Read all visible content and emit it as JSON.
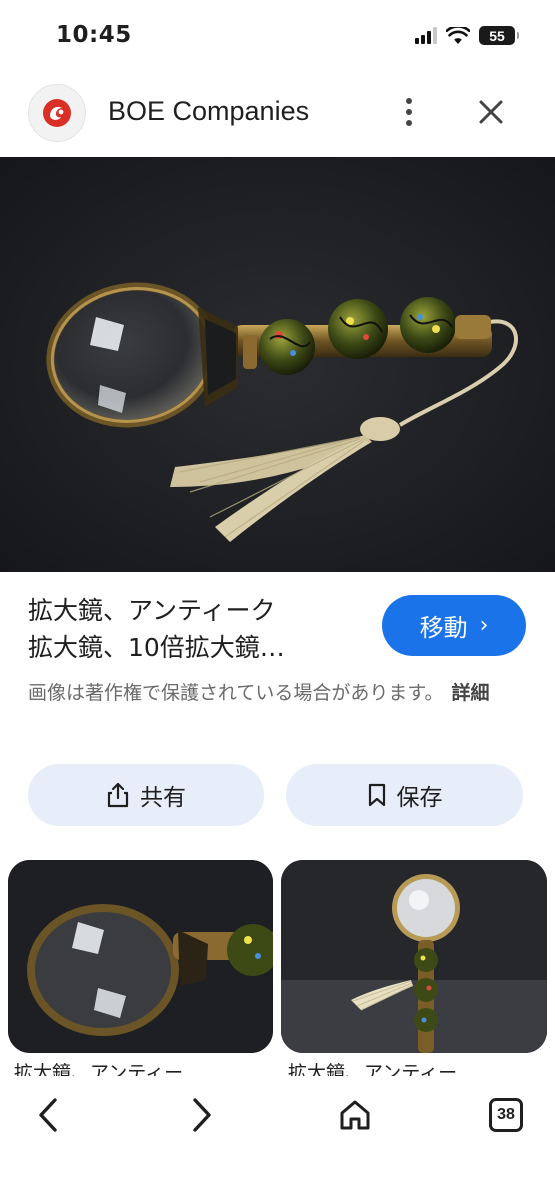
{
  "status_bar": {
    "time": "10:45",
    "battery": "55"
  },
  "header": {
    "site_name": "BOE Companies"
  },
  "image_title_lines": [
    "拡大鏡、アンティーク",
    "拡大鏡、10倍拡大鏡…"
  ],
  "visit_button": {
    "label": "移動",
    "chevron": "›"
  },
  "copyright": {
    "text": "画像は著作権で保護されている場合があります。",
    "more_label": "詳細"
  },
  "actions": {
    "share_label": "共有",
    "save_label": "保存"
  },
  "related": [
    {
      "caption": "拡大鏡、アンティー…"
    },
    {
      "caption": "拡大鏡、アンティー…"
    }
  ],
  "toolbar": {
    "tab_count": "38"
  },
  "colors": {
    "accent": "#1a73e8",
    "pill_bg": "#e8eef9",
    "logo_red": "#d93025"
  },
  "icons": [
    "site-logo-icon",
    "more-vert-icon",
    "close-icon",
    "share-icon",
    "bookmark-icon",
    "back-icon",
    "forward-icon",
    "home-icon",
    "tabs-icon"
  ]
}
